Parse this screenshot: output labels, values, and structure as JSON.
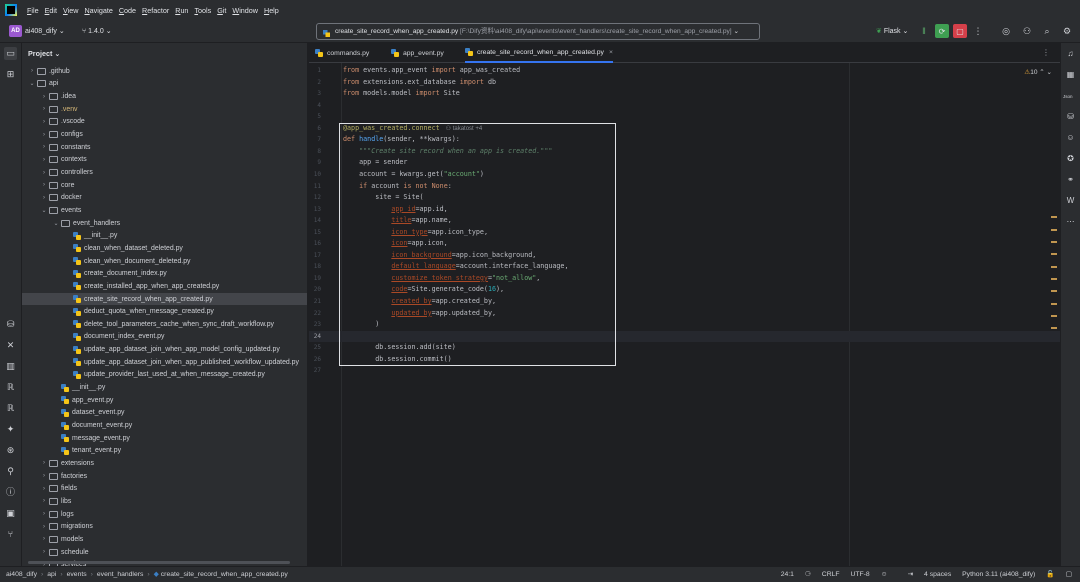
{
  "menu": [
    "File",
    "Edit",
    "View",
    "Navigate",
    "Code",
    "Refactor",
    "Run",
    "Tools",
    "Git",
    "Window",
    "Help"
  ],
  "toolbar": {
    "project_badge": "AD",
    "project_name": "ai408_dify",
    "branch": "1.4.0",
    "file_path_name": "create_site_record_when_app_created.py",
    "file_path_location": "[F:\\Dify资料\\ai408_dify\\api\\events\\event_handlers\\create_site_record_when_app_created.py]",
    "run_config": "Flask"
  },
  "project_panel": {
    "title": "Project",
    "rows": [
      {
        "label": ".github",
        "depth": 1,
        "type": "folder",
        "expanded": false
      },
      {
        "label": "api",
        "depth": 1,
        "type": "folder",
        "expanded": true
      },
      {
        "label": ".idea",
        "depth": 2,
        "type": "folder",
        "expanded": false
      },
      {
        "label": ".venv",
        "depth": 2,
        "type": "folder",
        "expanded": false,
        "excluded": true
      },
      {
        "label": ".vscode",
        "depth": 2,
        "type": "folder",
        "expanded": false
      },
      {
        "label": "configs",
        "depth": 2,
        "type": "folder",
        "expanded": false
      },
      {
        "label": "constants",
        "depth": 2,
        "type": "folder",
        "expanded": false
      },
      {
        "label": "contexts",
        "depth": 2,
        "type": "folder",
        "expanded": false
      },
      {
        "label": "controllers",
        "depth": 2,
        "type": "folder",
        "expanded": false
      },
      {
        "label": "core",
        "depth": 2,
        "type": "folder",
        "expanded": false
      },
      {
        "label": "docker",
        "depth": 2,
        "type": "folder",
        "expanded": false
      },
      {
        "label": "events",
        "depth": 2,
        "type": "folder",
        "expanded": true
      },
      {
        "label": "event_handlers",
        "depth": 3,
        "type": "folder",
        "expanded": true
      },
      {
        "label": "__init__.py",
        "depth": 4,
        "type": "file"
      },
      {
        "label": "clean_when_dataset_deleted.py",
        "depth": 4,
        "type": "file"
      },
      {
        "label": "clean_when_document_deleted.py",
        "depth": 4,
        "type": "file"
      },
      {
        "label": "create_document_index.py",
        "depth": 4,
        "type": "file"
      },
      {
        "label": "create_installed_app_when_app_created.py",
        "depth": 4,
        "type": "file"
      },
      {
        "label": "create_site_record_when_app_created.py",
        "depth": 4,
        "type": "file",
        "selected": true
      },
      {
        "label": "deduct_quota_when_message_created.py",
        "depth": 4,
        "type": "file"
      },
      {
        "label": "delete_tool_parameters_cache_when_sync_draft_workflow.py",
        "depth": 4,
        "type": "file"
      },
      {
        "label": "document_index_event.py",
        "depth": 4,
        "type": "file"
      },
      {
        "label": "update_app_dataset_join_when_app_model_config_updated.py",
        "depth": 4,
        "type": "file"
      },
      {
        "label": "update_app_dataset_join_when_app_published_workflow_updated.py",
        "depth": 4,
        "type": "file"
      },
      {
        "label": "update_provider_last_used_at_when_message_created.py",
        "depth": 4,
        "type": "file"
      },
      {
        "label": "__init__.py",
        "depth": 3,
        "type": "file"
      },
      {
        "label": "app_event.py",
        "depth": 3,
        "type": "file"
      },
      {
        "label": "dataset_event.py",
        "depth": 3,
        "type": "file"
      },
      {
        "label": "document_event.py",
        "depth": 3,
        "type": "file"
      },
      {
        "label": "message_event.py",
        "depth": 3,
        "type": "file"
      },
      {
        "label": "tenant_event.py",
        "depth": 3,
        "type": "file"
      },
      {
        "label": "extensions",
        "depth": 2,
        "type": "folder",
        "expanded": false
      },
      {
        "label": "factories",
        "depth": 2,
        "type": "folder",
        "expanded": false
      },
      {
        "label": "fields",
        "depth": 2,
        "type": "folder",
        "expanded": false
      },
      {
        "label": "libs",
        "depth": 2,
        "type": "folder",
        "expanded": false
      },
      {
        "label": "logs",
        "depth": 2,
        "type": "folder",
        "expanded": false
      },
      {
        "label": "migrations",
        "depth": 2,
        "type": "folder",
        "expanded": false
      },
      {
        "label": "models",
        "depth": 2,
        "type": "folder",
        "expanded": false
      },
      {
        "label": "schedule",
        "depth": 2,
        "type": "folder",
        "expanded": false
      },
      {
        "label": "services",
        "depth": 2,
        "type": "folder",
        "expanded": false
      }
    ]
  },
  "tabs": [
    {
      "label": "commands.py",
      "active": false
    },
    {
      "label": "app_event.py",
      "active": false
    },
    {
      "label": "create_site_record_when_app_created.py",
      "active": true
    }
  ],
  "editor": {
    "warnings": "10",
    "current_line": 24,
    "author_hint": "takatost +4",
    "lines": [
      [
        [
          "kw",
          "from "
        ],
        [
          "",
          "events.app_event "
        ],
        [
          "kw",
          "import "
        ],
        [
          "",
          "app_was_created"
        ]
      ],
      [
        [
          "kw",
          "from "
        ],
        [
          "",
          "extensions.ext_database "
        ],
        [
          "kw",
          "import "
        ],
        [
          "",
          "db"
        ]
      ],
      [
        [
          "kw",
          "from "
        ],
        [
          "",
          "models.model "
        ],
        [
          "kw",
          "import "
        ],
        [
          "",
          "Site"
        ]
      ],
      [],
      [],
      [
        [
          "dec",
          "@app_was_created.connect"
        ],
        [
          "hint",
          "takatost +4"
        ]
      ],
      [
        [
          "kw",
          "def "
        ],
        [
          "fn",
          "handle"
        ],
        [
          "",
          "(sender, **kwargs):"
        ]
      ],
      [
        [
          "",
          "    "
        ],
        [
          "doc",
          "\"\"\"Create site record when an app is created.\"\"\""
        ]
      ],
      [
        [
          "",
          "    app = sender"
        ]
      ],
      [
        [
          "",
          "    account = kwargs.get("
        ],
        [
          "str",
          "\"account\""
        ],
        [
          "",
          ")"
        ]
      ],
      [
        [
          "",
          "    "
        ],
        [
          "kw",
          "if "
        ],
        [
          "",
          "account "
        ],
        [
          "kw",
          "is not "
        ],
        [
          "kw",
          "None"
        ],
        [
          "",
          ":"
        ]
      ],
      [
        [
          "",
          "        site = Site("
        ]
      ],
      [
        [
          "",
          "            "
        ],
        [
          "param",
          "app_id"
        ],
        [
          "",
          "=app.id,"
        ]
      ],
      [
        [
          "",
          "            "
        ],
        [
          "param",
          "title"
        ],
        [
          "",
          "=app.name,"
        ]
      ],
      [
        [
          "",
          "            "
        ],
        [
          "param",
          "icon_type"
        ],
        [
          "",
          "=app.icon_type,"
        ]
      ],
      [
        [
          "",
          "            "
        ],
        [
          "param",
          "icon"
        ],
        [
          "",
          "=app.icon,"
        ]
      ],
      [
        [
          "",
          "            "
        ],
        [
          "param",
          "icon_background"
        ],
        [
          "",
          "=app.icon_background,"
        ]
      ],
      [
        [
          "",
          "            "
        ],
        [
          "param",
          "default_language"
        ],
        [
          "",
          "=account.interface_language,"
        ]
      ],
      [
        [
          "",
          "            "
        ],
        [
          "param",
          "customize_token_strategy"
        ],
        [
          "",
          "="
        ],
        [
          "str",
          "\"not_allow\""
        ],
        [
          "",
          ","
        ]
      ],
      [
        [
          "",
          "            "
        ],
        [
          "param",
          "code"
        ],
        [
          "",
          "=Site.generate_code("
        ],
        [
          "num",
          "16"
        ],
        [
          "",
          "),"
        ]
      ],
      [
        [
          "",
          "            "
        ],
        [
          "param",
          "created_by"
        ],
        [
          "",
          "=app.created_by,"
        ]
      ],
      [
        [
          "",
          "            "
        ],
        [
          "param",
          "updated_by"
        ],
        [
          "",
          "=app.updated_by,"
        ]
      ],
      [
        [
          "",
          "        )"
        ]
      ],
      [],
      [
        [
          "",
          "        db.session.add(site)"
        ]
      ],
      [
        [
          "",
          "        db.session.commit()"
        ]
      ],
      []
    ]
  },
  "statusbar": {
    "breadcrumbs": [
      "ai408_dify",
      "api",
      "events",
      "event_handlers",
      "create_site_record_when_app_created.py"
    ],
    "position": "24:1",
    "line_endings": "CRLF",
    "encoding": "UTF-8",
    "indent": "4 spaces",
    "interpreter": "Python 3.11 (ai408_dify)"
  }
}
